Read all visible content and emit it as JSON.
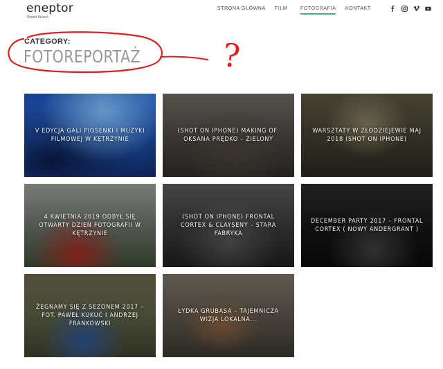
{
  "brand": {
    "name": "eneptor",
    "tagline": "Paweł Kukuć"
  },
  "nav": {
    "items": [
      {
        "label": "STRONA GŁÓWNA",
        "active": false
      },
      {
        "label": "FILM",
        "active": false
      },
      {
        "label": "FOTOGRAFIA",
        "active": true
      },
      {
        "label": "KONTAKT",
        "active": false
      }
    ],
    "accent_color": "#4caf7d"
  },
  "social": [
    {
      "icon": "facebook-icon"
    },
    {
      "icon": "instagram-icon"
    },
    {
      "icon": "vimeo-icon"
    },
    {
      "icon": "youtube-icon"
    }
  ],
  "category": {
    "label": "CATEGORY:",
    "title": "FOTOREPORTAŻ"
  },
  "annotation": {
    "mark": "?",
    "color": "#e02020"
  },
  "posts": [
    {
      "title": "V EDYCJA GALI PIOSENKI I MUZYKI FILMOWEJ W KĘTRZYNIE"
    },
    {
      "title": "(SHOT ON IPHONE) MAKING OF: OKSANA PRĘDKO – ZIELONY"
    },
    {
      "title": "WARSZTATY W ZŁODZIEJEWIE MAJ 2018 (SHOT ON IPHONE)"
    },
    {
      "title": "4 KWIETNIA 2019 ODBYŁ SIĘ OTWARTY DZIEŃ FOTOGRAFII W KĘTRZYNIE"
    },
    {
      "title": "(SHOT ON IPHONE) FRONTAL CORTEX & CLAYSENY – STARA FABRYKA"
    },
    {
      "title": "DECEMBER PARTY 2017 – FRONTAL CORTEX ( NOWY ANDERGRANT )"
    },
    {
      "title": "ŻEGNAMY SIĘ Z SEZONEM 2017 – FOT. PAWEŁ KUKUĆ I ANDRZEJ FRANKOWSKI"
    },
    {
      "title": "ŁYDKA GRUBASA – TAJEMNICZA WIZJA LOKALNA..."
    }
  ]
}
